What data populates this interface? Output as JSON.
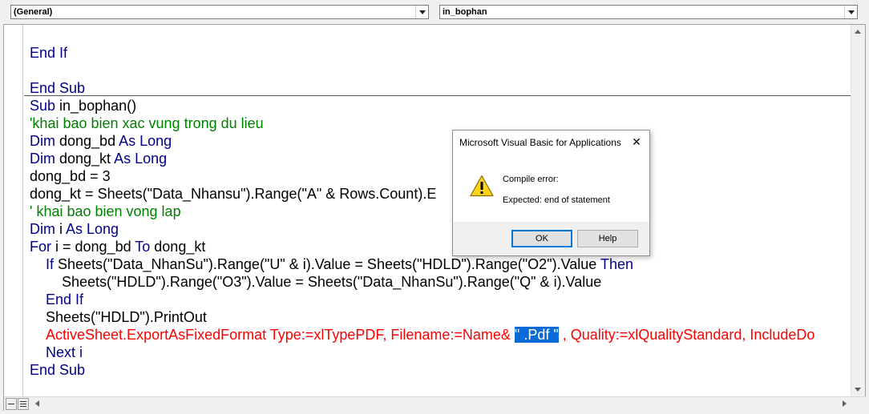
{
  "toolbar": {
    "object_combo": "(General)",
    "procedure_combo": "in_bophan"
  },
  "code": {
    "prev": {
      "end_if": "End If",
      "end_sub": "End Sub"
    },
    "l_sub_kw": "Sub",
    "l_sub_rest": " in_bophan()",
    "l_comment1": "'khai bao bien xac vung trong du lieu",
    "l_dim_kw1": "Dim",
    "l_dim_var1": " dong_bd ",
    "l_as_long1": "As Long",
    "l_dim_kw2": "Dim",
    "l_dim_var2": " dong_kt ",
    "l_as_long2": "As Long",
    "l_assign1": "dong_bd = 3",
    "l_assign2": "dong_kt = Sheets(\"Data_Nhansu\").Range(\"A\" & Rows.Count).E",
    "l_comment2": "' khai bao bien vong lap",
    "l_dim_kw3": "Dim",
    "l_dim_var3": " i ",
    "l_as_long3": "As Long",
    "l_for_kw": "For",
    "l_for_mid": " i = dong_bd ",
    "l_to_kw": "To",
    "l_for_end": " dong_kt",
    "l_if_kw": "If",
    "l_if_mid": " Sheets(\"Data_NhanSu\").Range(\"U\" & i).Value = Sheets(\"HDLD\").Range(\"O2\").Value ",
    "l_then_kw": "Then",
    "l_assign3": "Sheets(\"HDLD\").Range(\"O3\").Value = Sheets(\"Data_NhanSu\").Range(\"Q\" & i).Value",
    "l_endif": "End If",
    "l_printout": "Sheets(\"HDLD\").PrintOut",
    "l_export_a": "ActiveSheet.ExportAsFixedFormat Type:=xlTypePDF, Filename:=Name& ",
    "l_export_sel": "\" .Pdf \"",
    "l_export_b": " , Quality:=xlQualityStandard, IncludeDo",
    "l_next": "Next i",
    "l_endsub": "End Sub"
  },
  "dialog": {
    "title": "Microsoft Visual Basic for Applications",
    "close": "✕",
    "message_line1": "Compile error:",
    "message_line2": "Expected: end of statement",
    "ok_label": "OK",
    "help_label": "Help",
    "icon": "warning-icon"
  },
  "colors": {
    "keyword": "#00008b",
    "comment": "#008000",
    "error_line": "#ff0000",
    "selection": "#0a6ad6"
  }
}
